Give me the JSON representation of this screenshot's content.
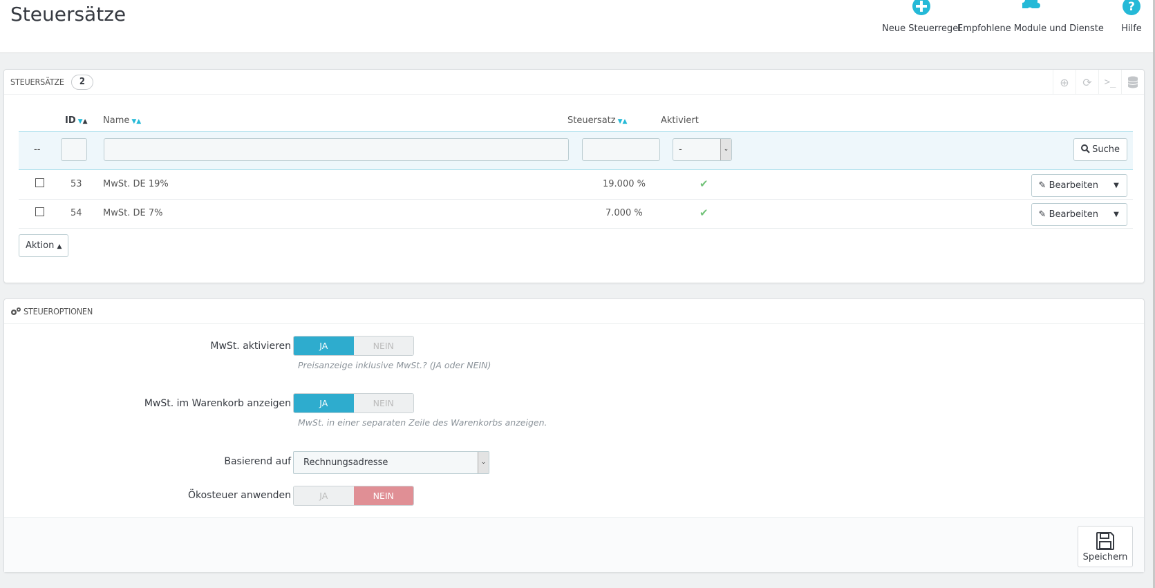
{
  "page": {
    "title": "Steuersätze"
  },
  "toolbar": {
    "new_rule_label": "Neue Steuerregel",
    "modules_label": "Empfohlene Module und Dienste",
    "help_label": "Hilfe"
  },
  "rates_panel": {
    "title": "Steuersätze",
    "count": "2",
    "columns": {
      "id": "ID",
      "name": "Name",
      "rate": "Steuersatz",
      "active": "Aktiviert"
    },
    "filter": {
      "placeholder_dash": "--",
      "active_value": "-",
      "search_label": "Suche"
    },
    "rows": [
      {
        "id": "53",
        "name": "MwSt. DE 19%",
        "rate": "19.000 %",
        "active": true,
        "edit_label": "Bearbeiten"
      },
      {
        "id": "54",
        "name": "MwSt. DE 7%",
        "rate": "7.000 %",
        "active": true,
        "edit_label": "Bearbeiten"
      }
    ],
    "bulk_action_label": "Aktion"
  },
  "options_panel": {
    "title": "Steueroptionen",
    "enable_tax": {
      "label": "MwSt. aktivieren",
      "yes": "JA",
      "no": "NEIN",
      "value": "JA",
      "help": "Preisanzeige inklusive MwSt.? (JA oder NEIN)"
    },
    "display_tax_in_cart": {
      "label": "MwSt. im Warenkorb anzeigen",
      "yes": "JA",
      "no": "NEIN",
      "value": "JA",
      "help": "MwSt. in einer separaten Zeile des Warenkorbs anzeigen."
    },
    "based_on": {
      "label": "Basierend auf",
      "value": "Rechnungsadresse"
    },
    "ecotax": {
      "label": "Ökosteuer anwenden",
      "yes": "JA",
      "no": "NEIN",
      "value": "NEIN"
    },
    "save_label": "Speichern"
  },
  "colors": {
    "accent": "#25b9d7",
    "switch_on": "#2eacce",
    "switch_negative": "#e08f95",
    "check_green": "#72c279"
  }
}
